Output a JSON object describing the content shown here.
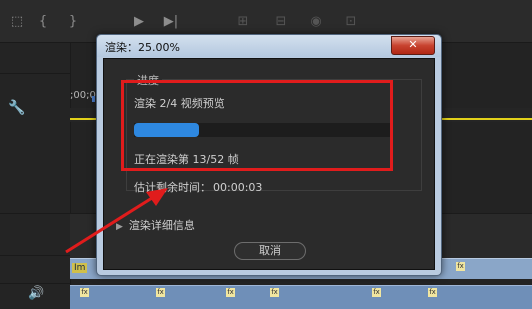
{
  "dialog": {
    "title": "渲染：25.00%",
    "close_label": "✕",
    "group_label": "进度",
    "stage_text": "渲染 2/4 视频预览",
    "progress_fraction": 0.25,
    "frame_text": "正在渲染第 13/52 帧",
    "eta_label": "估计剩余时间：",
    "eta_value": "00:00:03",
    "details_label": "渲染详细信息",
    "cancel_label": "取消"
  },
  "timeline": {
    "timecode": ";00;00",
    "clip_label": "Im",
    "fx_badge": "fx"
  },
  "colors": {
    "annotation_red": "#e01c1c",
    "progress_blue": "#2e88e0",
    "titlebar": "#b9cbe0",
    "clip_blue": "#8aa6c8"
  },
  "icons": [
    "wrench-icon",
    "speaker-icon",
    "close-icon",
    "expand-arrow-icon"
  ]
}
